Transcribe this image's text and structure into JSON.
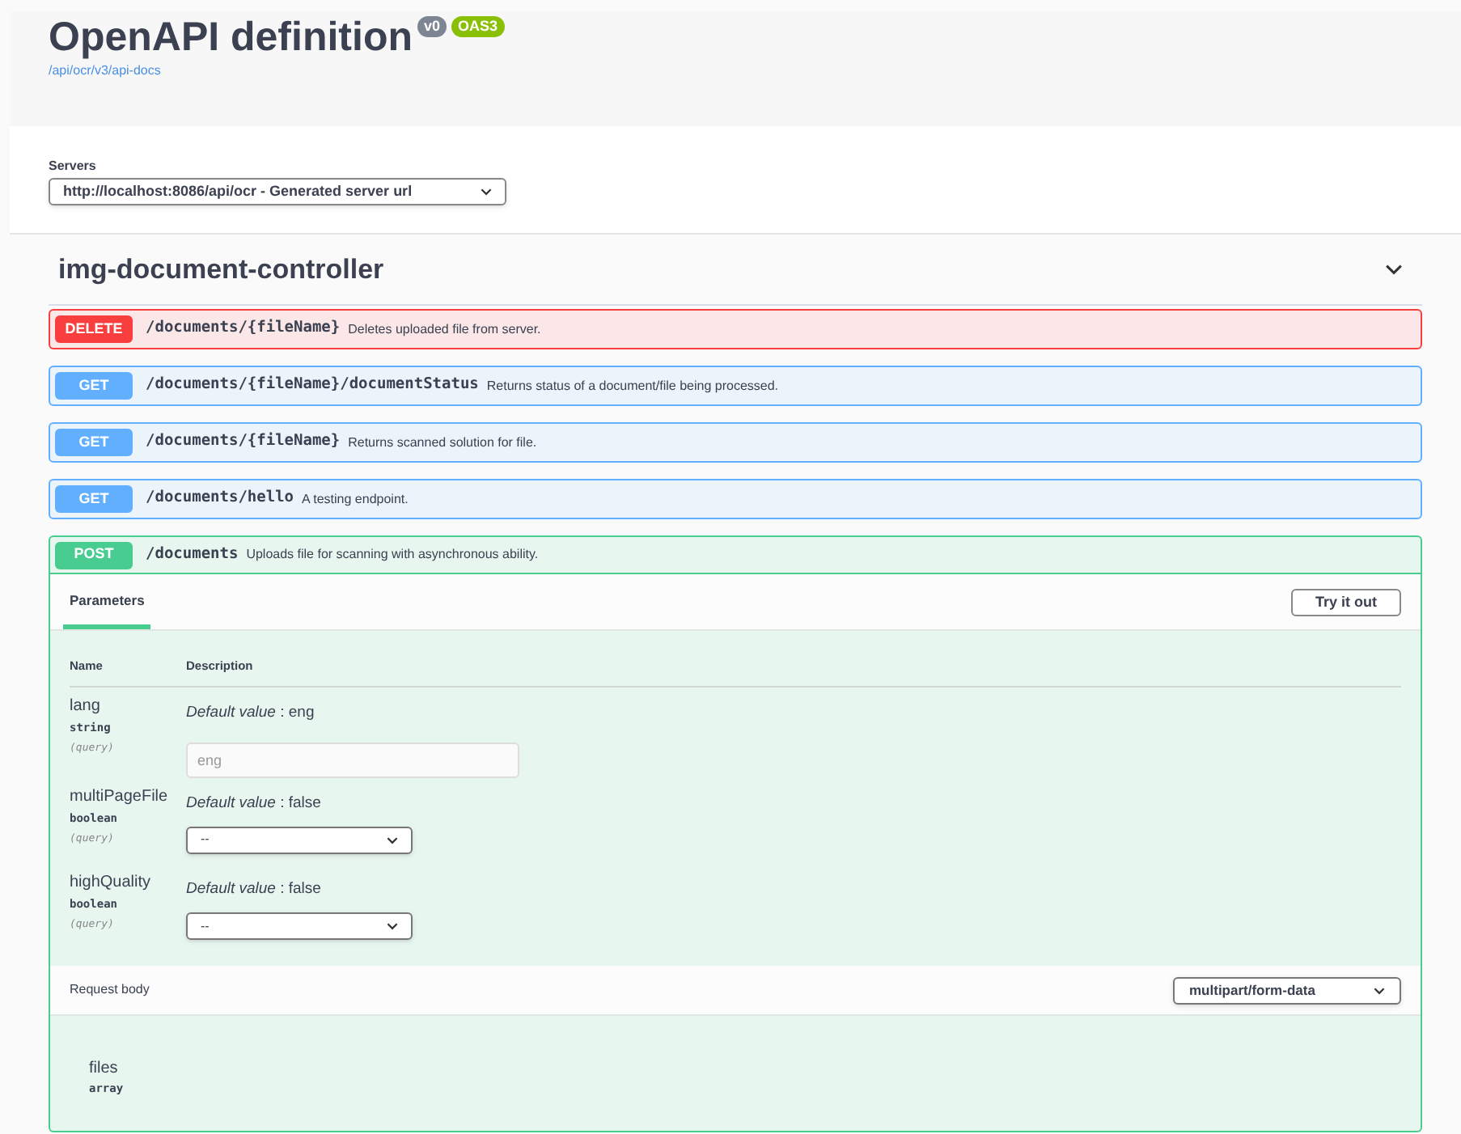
{
  "info": {
    "title": "OpenAPI definition",
    "version": "v0",
    "spec": "OAS3",
    "url": "/api/ocr/v3/api-docs"
  },
  "servers": {
    "label": "Servers",
    "value": "http://localhost:8086/api/ocr - Generated server url"
  },
  "tag": {
    "name": "img-document-controller",
    "expanded": true
  },
  "operations": [
    {
      "method": "DELETE",
      "kind": "delete",
      "path": "/documents/{fileName}",
      "summary": "Deletes uploaded file from server.",
      "expanded": false
    },
    {
      "method": "GET",
      "kind": "get",
      "path": "/documents/{fileName}/documentStatus",
      "summary": "Returns status of a document/file being processed.",
      "expanded": false
    },
    {
      "method": "GET",
      "kind": "get",
      "path": "/documents/{fileName}",
      "summary": "Returns scanned solution for file.",
      "expanded": false
    },
    {
      "method": "GET",
      "kind": "get",
      "path": "/documents/hello",
      "summary": "A testing endpoint.",
      "expanded": false
    },
    {
      "method": "POST",
      "kind": "post",
      "path": "/documents",
      "summary": "Uploads file for scanning with asynchronous ability.",
      "expanded": true
    }
  ],
  "details": {
    "tab": {
      "label": "Parameters",
      "selected": true
    },
    "try_button": "Try it out",
    "columns": [
      "Name",
      "Description"
    ],
    "parameters": [
      {
        "name": "lang",
        "type": "string",
        "in": "(query)",
        "default": "*Default value* : eng",
        "kind": "text",
        "placeholder": "eng"
      },
      {
        "name": "multiPageFile",
        "type": "boolean",
        "in": "(query)",
        "default": "*Default value* : false",
        "kind": "select",
        "value": "--"
      },
      {
        "name": "highQuality",
        "type": "boolean",
        "in": "(query)",
        "default": "*Default value* : false",
        "kind": "select",
        "value": "--"
      }
    ],
    "request_body": {
      "label": "Request body",
      "content_type": "multipart/form-data"
    },
    "body_fields": [
      {
        "name": "files",
        "type": "array"
      }
    ]
  }
}
